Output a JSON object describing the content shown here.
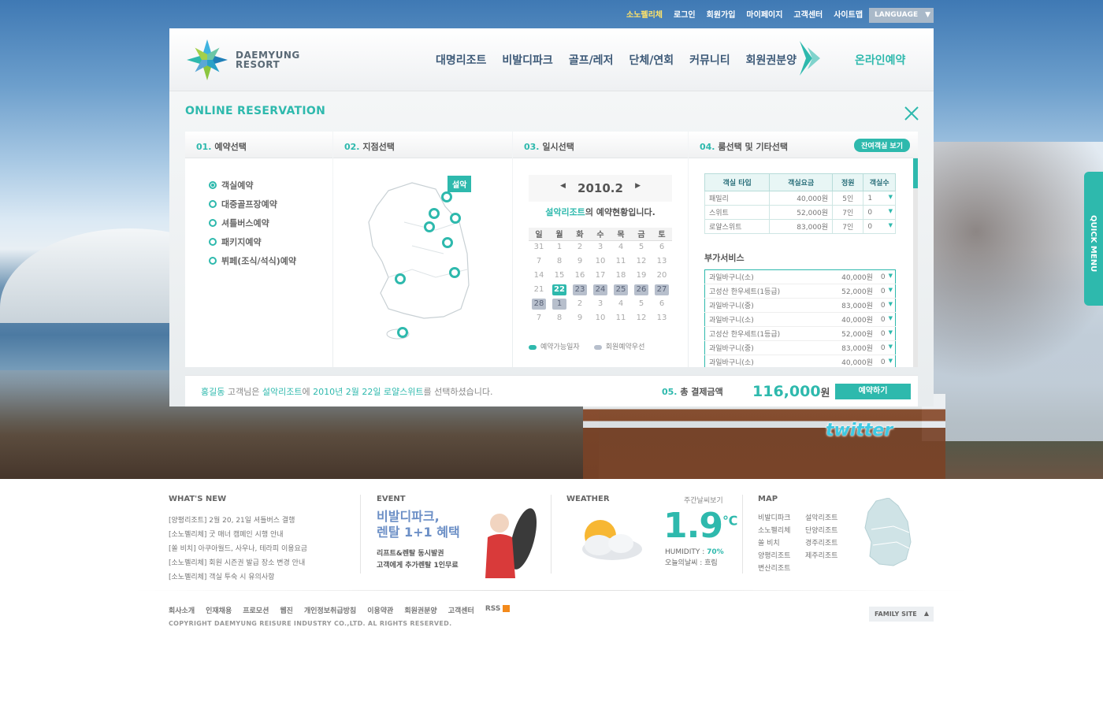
{
  "top_nav": [
    "소노펠리체",
    "로그인",
    "회원가입",
    "마이페이지",
    "고객센터",
    "사이트맵"
  ],
  "language_label": "LANGUAGE",
  "logo": {
    "line1": "DAEMYUNG",
    "line2": "RESORT"
  },
  "gnb": [
    "대명리조트",
    "비발디파크",
    "골프/레저",
    "단체/연회",
    "커뮤니티",
    "회원권분양"
  ],
  "online_booking": "온라인예약",
  "reservation_title": "ONLINE RESERVATION",
  "steps": {
    "s1": {
      "num": "01.",
      "label": "예약선택"
    },
    "s2": {
      "num": "02.",
      "label": "지점선택"
    },
    "s3": {
      "num": "03.",
      "label": "일시선택"
    },
    "s4": {
      "num": "04.",
      "label": "룸선택 및 기타선택"
    }
  },
  "options": [
    "객실예약",
    "대중골프장예약",
    "셔틀버스예약",
    "패키지예약",
    "뷔페(조식/석식)예약"
  ],
  "map_tag": "설악",
  "calendar": {
    "month": "2010.2",
    "resort": "설악리조트",
    "desc_suffix": "의 예약현황입니다.",
    "weekdays": [
      "일",
      "월",
      "화",
      "수",
      "목",
      "금",
      "토"
    ],
    "weeks": [
      [
        "31",
        "1",
        "2",
        "3",
        "4",
        "5",
        "6"
      ],
      [
        "7",
        "8",
        "9",
        "10",
        "11",
        "12",
        "13"
      ],
      [
        "14",
        "15",
        "16",
        "17",
        "18",
        "19",
        "20"
      ],
      [
        "21",
        "22",
        "23",
        "24",
        "25",
        "26",
        "27"
      ],
      [
        "28",
        "1",
        "2",
        "3",
        "4",
        "5",
        "6"
      ],
      [
        "7",
        "8",
        "9",
        "10",
        "11",
        "12",
        "13"
      ]
    ],
    "legend_avail": "예약가능일자",
    "legend_member": "회원예약우선"
  },
  "vacancy_button": "잔여객실 보기",
  "room_table": {
    "headers": [
      "객실 타입",
      "객실요금",
      "정원",
      "객실수"
    ],
    "rows": [
      [
        "패밀리",
        "40,000원",
        "5인",
        "1"
      ],
      [
        "스위트",
        "52,000원",
        "7인",
        "0"
      ],
      [
        "로얄스위트",
        "83,000원",
        "7인",
        "0"
      ]
    ]
  },
  "addon_title": "부가서비스",
  "addons": [
    [
      "과일바구니(소)",
      "40,000원",
      "0"
    ],
    [
      "고성산 한우세트(1등급)",
      "52,000원",
      "0"
    ],
    [
      "과일바구니(중)",
      "83,000원",
      "0"
    ],
    [
      "과일바구니(소)",
      "40,000원",
      "0"
    ],
    [
      "고성산 한우세트(1등급)",
      "52,000원",
      "0"
    ],
    [
      "과일바구니(중)",
      "83,000원",
      "0"
    ],
    [
      "과일바구니(소)",
      "40,000원",
      "0"
    ]
  ],
  "summary": {
    "name": "홍길동",
    "p1": " 고객님은 ",
    "resort": "설악리조트",
    "p2": "에 ",
    "date": "2010년 2월 22일 로얄스위트",
    "p3": "를 선택하셨습니다."
  },
  "total": {
    "num": "05.",
    "label": "총 결제금액",
    "amount": "116,000",
    "unit": "원"
  },
  "reserve_button": "예약하기",
  "quick_menu": "QUICK MENU",
  "twitter": "twitter",
  "whats_new": {
    "title": "WHAT'S NEW",
    "items": [
      "[양평리조트] 2월 20, 21일 셔틀버스 결행",
      "[소노펠리체] 굿 매너 캠페인 시행 안내",
      "[쏠 비치] 아쿠아월드, 사우나, 테라피 이용요금",
      "[소노펠리체] 회원 시즌권 발급 장소 변경 안내",
      "[소노펠리체] 객실 투숙 시 유의사항"
    ]
  },
  "event": {
    "title": "EVENT",
    "headline1": "비발디파크,",
    "headline2": "렌탈 1+1 혜택",
    "line1": "리프트&렌탈 동시발권",
    "line2": "고객에게 추가렌탈 1인무료"
  },
  "weather": {
    "title": "WEATHER",
    "weekly": "주간날씨보기",
    "temp": "1.9",
    "unit": "℃",
    "humidity_label": "HUMIDITY : ",
    "humidity": "70%",
    "today": "오늘의날씨 : 흐림"
  },
  "map": {
    "title": "MAP",
    "col1": [
      "비발디파크",
      "소노펠리체",
      "쏠 비치",
      "양평리조트",
      "변산리조트"
    ],
    "col2": [
      "설악리조트",
      "단양리조트",
      "경주리조트",
      "제주리조트"
    ]
  },
  "footer_links": [
    "회사소개",
    "인재채용",
    "프로모션",
    "웹진",
    "개인정보취급방침",
    "이용약관",
    "회원권분양",
    "고객센터",
    "RSS"
  ],
  "copyright": "COPYRIGHT DAEMYUNG REISURE INDUSTRY CO.,LTD. AL RIGHTS RESERVED.",
  "family_site": "FAMILY SITE",
  "colors": {
    "accent": "#2eb9ad",
    "nav": "#3d5a78"
  }
}
